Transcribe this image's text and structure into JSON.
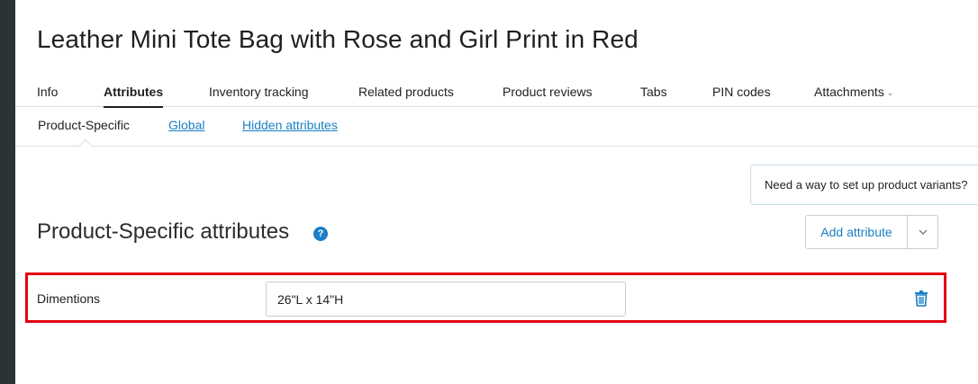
{
  "page": {
    "title": "Leather Mini Tote Bag with Rose and Girl Print in Red"
  },
  "tabs": [
    {
      "label": "Info",
      "active": false
    },
    {
      "label": "Attributes",
      "active": true
    },
    {
      "label": "Inventory tracking",
      "active": false
    },
    {
      "label": "Related products",
      "active": false
    },
    {
      "label": "Product reviews",
      "active": false
    },
    {
      "label": "Tabs",
      "active": false
    },
    {
      "label": "PIN codes",
      "active": false
    },
    {
      "label": "Attachments",
      "active": false,
      "dropdown": true
    }
  ],
  "subtabs": [
    {
      "label": "Product-Specific",
      "current": true
    },
    {
      "label": "Global",
      "current": false
    },
    {
      "label": "Hidden attributes",
      "current": false
    }
  ],
  "notice": {
    "text": "Need a way to set up product variants?"
  },
  "section": {
    "title": "Product-Specific attributes",
    "help_icon": "question-circle-icon",
    "help_glyph": "?"
  },
  "actions": {
    "add_label": "Add attribute",
    "toggle_icon": "chevron-down-icon"
  },
  "attributes": [
    {
      "name": "Dimentions",
      "value": "26\"L x 14\"H",
      "highlighted": true
    }
  ],
  "colors": {
    "accent": "#1a7fc4",
    "highlight": "#e3000f",
    "rail": "#2b3337"
  }
}
